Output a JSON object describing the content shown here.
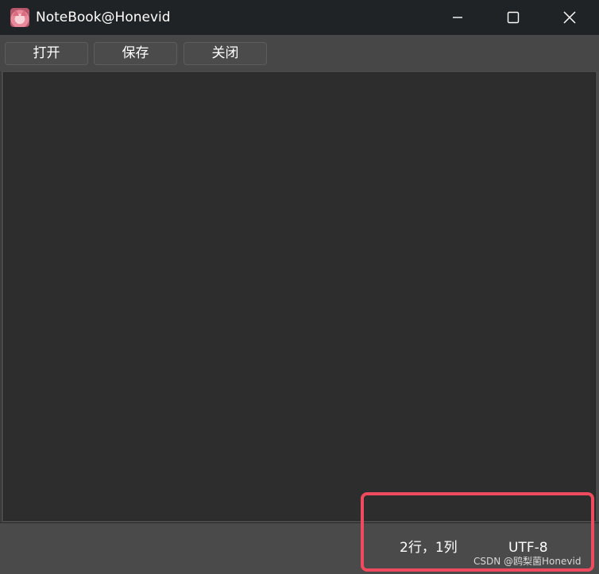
{
  "window": {
    "title": "NoteBook@Honevid",
    "app_icon": "anime-avatar-icon",
    "controls": [
      "minimize-icon",
      "maximize-icon",
      "close-icon"
    ]
  },
  "toolbar": {
    "open_label": "打开",
    "save_label": "保存",
    "close_label": "关闭"
  },
  "editor": {
    "content": ""
  },
  "status": {
    "position": "2行，1列",
    "encoding": "UTF-8"
  },
  "watermark": "CSDN @鸥梨菌Honevid",
  "colors": {
    "titlebar_bg": "#1f2326",
    "editor_bg": "#2d2d2d",
    "toolbar_bg": "#474747",
    "highlight": "#f04a5e"
  }
}
